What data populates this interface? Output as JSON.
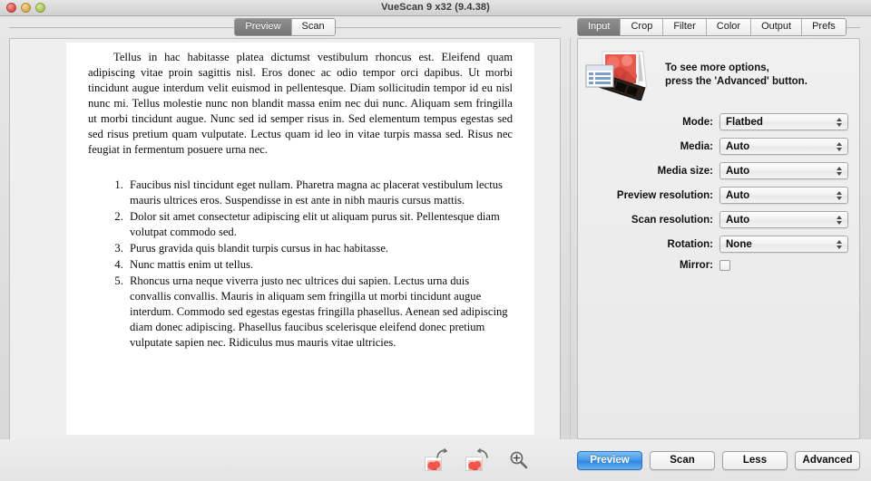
{
  "window": {
    "title": "VueScan 9 x32 (9.4.38)",
    "controls": {
      "close": "close",
      "minimize": "minimize",
      "zoom": "zoom"
    }
  },
  "preview_tabs": [
    {
      "label": "Preview",
      "active": true
    },
    {
      "label": "Scan",
      "active": false
    }
  ],
  "document": {
    "paragraph": "Tellus in hac habitasse platea dictumst vestibulum rhoncus est. Eleifend quam adipiscing vitae proin sagittis nisl. Eros donec ac odio tempor orci dapibus. Ut morbi tincidunt augue interdum velit euismod in pellentesque. Diam sollicitudin tempor id eu nisl nunc mi. Tellus molestie nunc non blandit massa enim nec dui nunc. Aliquam sem fringilla ut morbi tincidunt augue. Nunc sed id semper risus in. Sed elementum tempus egestas sed sed risus pretium quam vulputate. Lectus quam id leo in vitae turpis massa sed. Risus nec feugiat in fermentum posuere urna nec.",
    "list": [
      "Faucibus nisl tincidunt eget nullam. Pharetra magna ac placerat vestibulum lectus mauris ultrices eros. Suspendisse in est ante in nibh mauris cursus mattis.",
      "Dolor sit amet consectetur adipiscing elit ut aliquam purus sit. Pellentesque diam volutpat commodo sed.",
      "Purus gravida quis blandit turpis cursus in hac habitasse.",
      "Nunc mattis enim ut tellus.",
      "Rhoncus urna neque viverra justo nec ultrices dui sapien. Lectus urna duis convallis convallis. Mauris in aliquam sem fringilla ut morbi tincidunt augue interdum. Commodo sed egestas egestas fringilla phasellus. Aenean sed adipiscing diam donec adipiscing. Phasellus faucibus scelerisque eleifend donec pretium vulputate sapien nec. Ridiculus mus mauris vitae ultricies."
    ]
  },
  "preview_toolbar": [
    {
      "name": "rotate-left",
      "label": "Rotate left"
    },
    {
      "name": "rotate-right",
      "label": "Rotate right"
    },
    {
      "name": "zoom-in",
      "label": "Zoom in"
    }
  ],
  "panel_tabs": [
    {
      "label": "Input",
      "active": true
    },
    {
      "label": "Crop",
      "active": false
    },
    {
      "label": "Filter",
      "active": false
    },
    {
      "label": "Color",
      "active": false
    },
    {
      "label": "Output",
      "active": false
    },
    {
      "label": "Prefs",
      "active": false
    }
  ],
  "hint": {
    "line1": "To see more options,",
    "line2": "press the 'Advanced' button."
  },
  "fields": [
    {
      "label": "Mode:",
      "value": "Flatbed",
      "type": "select"
    },
    {
      "label": "Media:",
      "value": "Auto",
      "type": "select"
    },
    {
      "label": "Media size:",
      "value": "Auto",
      "type": "select"
    },
    {
      "label": "Preview resolution:",
      "value": "Auto",
      "type": "select"
    },
    {
      "label": "Scan resolution:",
      "value": "Auto",
      "type": "select"
    },
    {
      "label": "Rotation:",
      "value": "None",
      "type": "select"
    },
    {
      "label": "Mirror:",
      "value": "",
      "type": "checkbox",
      "checked": false
    }
  ],
  "buttons": [
    {
      "label": "Preview",
      "primary": true
    },
    {
      "label": "Scan",
      "primary": false
    },
    {
      "label": "Less",
      "primary": false
    },
    {
      "label": "Advanced",
      "primary": false
    }
  ],
  "colors": {
    "accent": "#3b92e8",
    "window_bg": "#e6e6e6",
    "panel_bg": "#eeeeee",
    "page_bg": "#ffffff"
  }
}
